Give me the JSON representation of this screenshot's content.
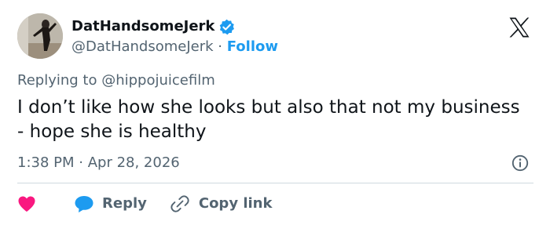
{
  "tweet": {
    "author": {
      "display_name": "DatHandsomeJerk",
      "handle": "@DatHandsomeJerk",
      "separator": " · ",
      "follow_label": "Follow",
      "verified": true
    },
    "replying_prefix": "Replying to ",
    "replying_to": "@hippojuicefilm",
    "text": "I don’t like how she looks but also that not my business - hope she is healthy",
    "time": "1:38 PM",
    "meta_separator": " · ",
    "date": "Apr 28, 2026"
  },
  "actions": {
    "reply_label": "Reply",
    "copy_link_label": "Copy link"
  },
  "colors": {
    "accent": "#1d9bf0",
    "like": "#f91880",
    "text_primary": "#0f1419",
    "text_secondary": "#536471",
    "divider": "#cfd9de"
  },
  "icons": {
    "verified": "verified-badge-icon",
    "brand": "x-logo-icon",
    "info": "info-icon",
    "like": "heart-icon",
    "reply": "speech-bubble-icon",
    "copy_link": "link-icon"
  }
}
